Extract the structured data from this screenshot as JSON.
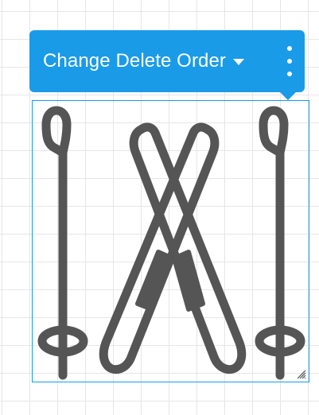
{
  "toolbar": {
    "label": "Change Delete Order",
    "background_color": "#1a9be8",
    "dropdown_icon": "caret-down-icon",
    "more_icon": "vertical-dots-icon"
  },
  "artwork": {
    "icon": "skis-and-poles-icon",
    "stroke_color": "#555555"
  },
  "selection": {
    "border_color": "#1a9be8",
    "resize_icon": "resize-handle-icon"
  }
}
